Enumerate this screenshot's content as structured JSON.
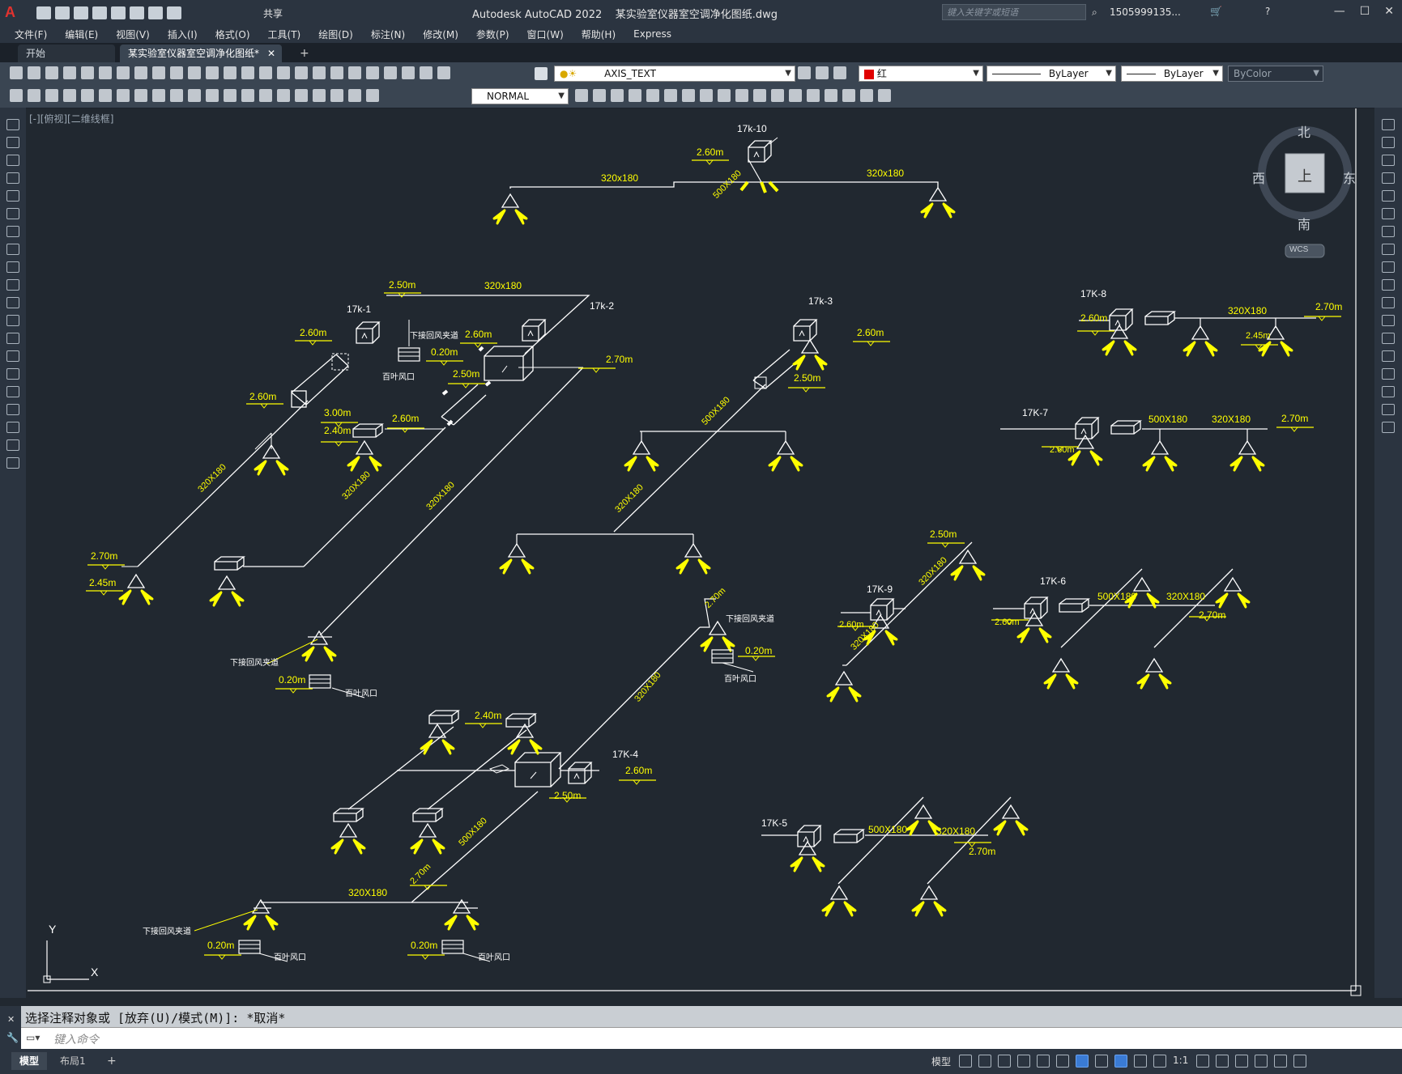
{
  "app": {
    "title": "Autodesk AutoCAD 2022    某实验室仪器室空调净化图纸.dwg",
    "search_placeholder": "键入关键字或短语",
    "user": "1505999135...",
    "share": "共享"
  },
  "menu": [
    "文件(F)",
    "编辑(E)",
    "视图(V)",
    "插入(I)",
    "格式(O)",
    "工具(T)",
    "绘图(D)",
    "标注(N)",
    "修改(M)",
    "参数(P)",
    "窗口(W)",
    "帮助(H)",
    "Express"
  ],
  "tabs": {
    "start": "开始",
    "active": "某实验室仪器室空调净化图纸*",
    "add": "+"
  },
  "toolbar": {
    "layer": "AXIS_TEXT",
    "color": "红",
    "color_hex": "#e00000",
    "linetype": "ByLayer",
    "lineweight": "ByLayer",
    "plotstyle": "ByColor",
    "dimstyle": "NORMAL"
  },
  "viewport": {
    "label": "[-][俯视][二维线框]"
  },
  "viewcube": {
    "north": "北",
    "south": "南",
    "east": "东",
    "west": "西",
    "top": "上",
    "wcs": "WCS"
  },
  "ucs": {
    "x": "X",
    "y": "Y"
  },
  "drawing": {
    "colors": {
      "line": "#ffffff",
      "annotation": "#ffff00",
      "background": "#212830"
    },
    "units": {
      "17k-10": {
        "name": "17k-10",
        "dims": [
          "320x180",
          "500X180",
          "320x180"
        ],
        "elev": [
          "2.60m"
        ]
      },
      "17k-1": {
        "name": "17k-1",
        "dims": [
          "320X180"
        ],
        "elev": [
          "2.60m",
          "2.60m",
          "2.70m",
          "2.45m"
        ]
      },
      "17k-2": {
        "name": "17k-2",
        "dims": [
          "320x180",
          "320X180",
          "320X180"
        ],
        "elev": [
          "2.50m",
          "2.60m",
          "0.20m",
          "2.50m",
          "2.70m",
          "3.00m",
          "2.40m",
          "2.60m"
        ]
      },
      "17k-3": {
        "name": "17k-3",
        "dims": [
          "500X180",
          "320X180"
        ],
        "elev": [
          "2.60m",
          "2.50m"
        ]
      },
      "17K-4": {
        "name": "17K-4",
        "dims": [
          "320X180",
          "500X180",
          "320X180"
        ],
        "elev": [
          "2.70m",
          "0.20m",
          "2.40m",
          "2.60m",
          "2.50m",
          "2.70m",
          "0.20m",
          "0.20m"
        ]
      },
      "17K-5": {
        "name": "17K-5",
        "dims": [
          "500X180",
          "320X180"
        ],
        "elev": [
          "2.70m"
        ]
      },
      "17K-6": {
        "name": "17K-6",
        "dims": [
          "500X180",
          "320X180"
        ],
        "elev": [
          "2.60m",
          "2.70m"
        ]
      },
      "17K-7": {
        "name": "17K-7",
        "dims": [
          "500X180",
          "320X180"
        ],
        "elev": [
          "2.60m",
          "2.70m"
        ]
      },
      "17K-8": {
        "name": "17K-8",
        "dims": [
          "320X180"
        ],
        "elev": [
          "2.60m",
          "2.45m",
          "2.70m"
        ]
      },
      "17K-9": {
        "name": "17K-9",
        "dims": [
          "320X180",
          "320X180"
        ],
        "elev": [
          "2.50m",
          "2.60m"
        ]
      }
    },
    "notes": {
      "return_shaft": "下接回风夹道",
      "louver": "百叶风口"
    }
  },
  "command": {
    "history": "选择注释对象或 [放弃(U)/模式(M)]: *取消*",
    "placeholder": "键入命令"
  },
  "status": {
    "model": "模型",
    "layout": "布局1",
    "add": "+",
    "scale": "1:1"
  }
}
